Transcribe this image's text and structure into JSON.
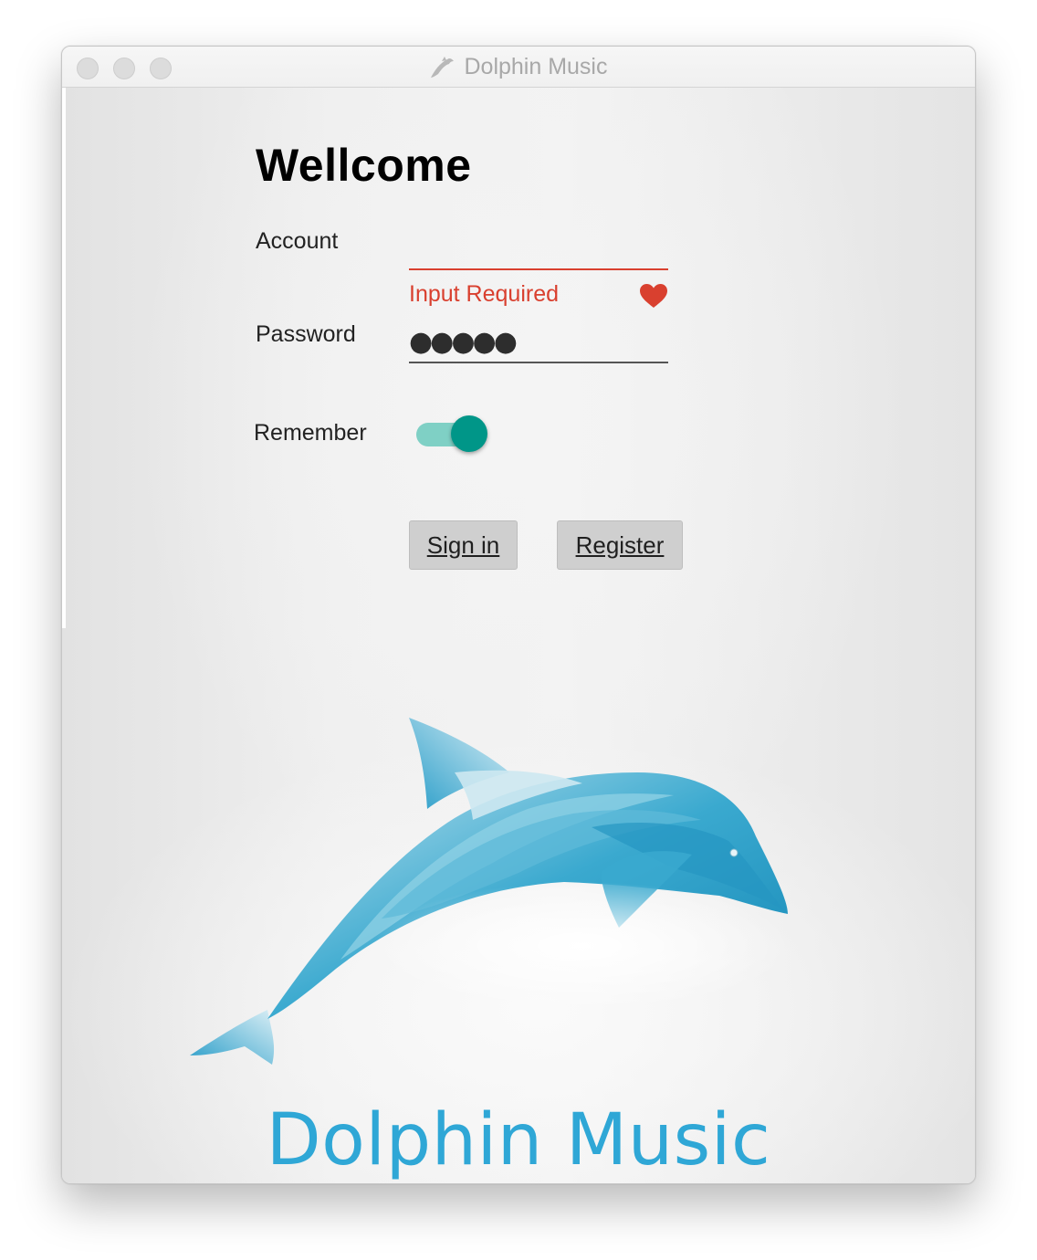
{
  "window": {
    "title": "Dolphin Music",
    "app_icon": "dolphin-icon"
  },
  "form": {
    "heading": "Wellcome",
    "account_label": "Account",
    "account_value": "",
    "account_error": "Input Required",
    "error_icon": "heart-icon",
    "password_label": "Password",
    "password_value": "●●●●●",
    "remember_label": "Remember",
    "remember_on": true,
    "signin_label": "Sign in",
    "register_label": "Register"
  },
  "branding": {
    "logo": "dolphin-logo",
    "logo_text": "Dolphin Music"
  },
  "colors": {
    "error": "#d9402f",
    "toggle_on": "#009688",
    "toggle_track": "#7fd0c5",
    "brand_blue": "#2fa7d6"
  }
}
